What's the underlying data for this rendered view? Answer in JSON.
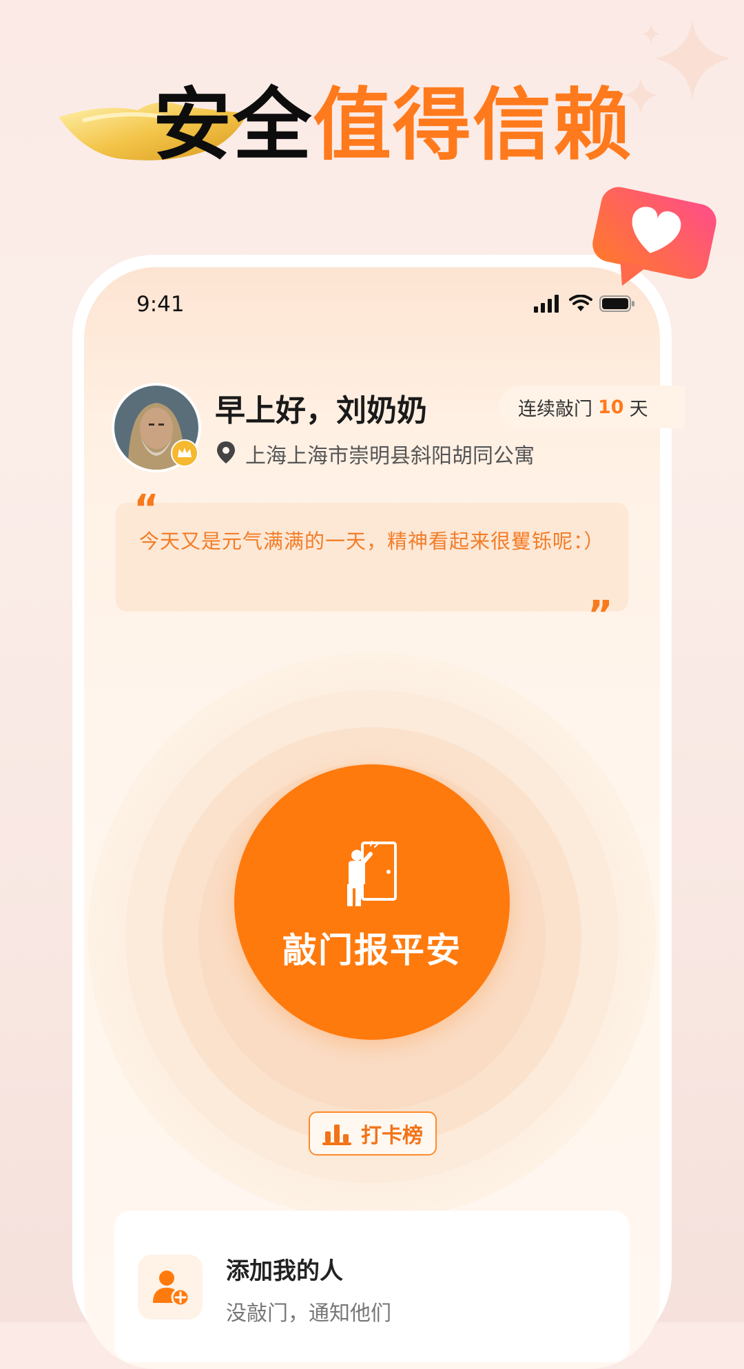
{
  "banner": {
    "headline_black": "安全",
    "headline_orange": "值得信赖"
  },
  "status_bar": {
    "time": "9:41"
  },
  "profile": {
    "greeting": "早上好，刘奶奶",
    "address": "上海上海市崇明县斜阳胡同公寓",
    "streak_prefix": "连续敲门",
    "streak_count": "10",
    "streak_suffix": "天"
  },
  "quote": {
    "open_mark": "“",
    "text": "今天又是元气满满的一天，精神看起来很矍铄呢：）",
    "close_mark": "”"
  },
  "knock": {
    "label": "敲门报平安"
  },
  "rank": {
    "label": "打卡榜"
  },
  "card": {
    "title": "添加我的人",
    "subtitle": "没敲门，通知他们"
  },
  "colors": {
    "accent": "#ff7a0d",
    "headline_orange": "#ff7a1c",
    "quote_bg": "#fde8d6"
  },
  "icons": [
    "gold-ingot-icon",
    "sparkle-icon",
    "heart-message-icon",
    "signal-icon",
    "wifi-icon",
    "battery-icon",
    "crown-icon",
    "location-pin-icon",
    "knock-door-icon",
    "bar-chart-icon",
    "add-person-icon"
  ]
}
